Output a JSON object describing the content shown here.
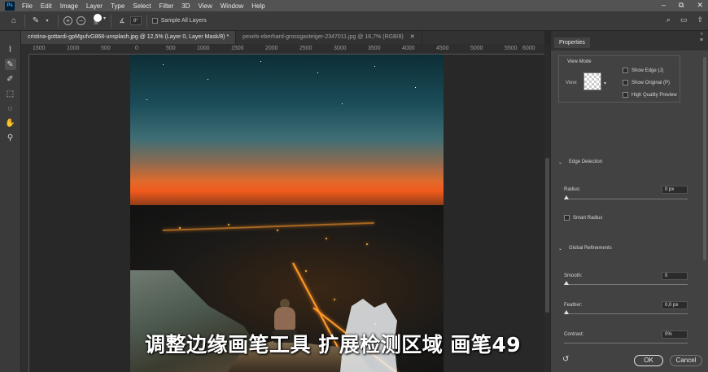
{
  "app": {
    "logo": "Ps"
  },
  "menu": [
    "File",
    "Edit",
    "Image",
    "Layer",
    "Type",
    "Select",
    "Filter",
    "3D",
    "View",
    "Window",
    "Help"
  ],
  "window_controls": {
    "minimize": "–",
    "restore": "⧉",
    "close": "✕"
  },
  "options_bar": {
    "brush_size": "30",
    "angle_value": "0°",
    "sample_all_layers_label": "Sample All Layers",
    "sample_all_layers_checked": false
  },
  "tabs": [
    {
      "label": "cristina-gottardi-gpMgufvG868-unsplash.jpg @ 12,5% (Layer 0, Layer Mask/8) *",
      "active": true
    },
    {
      "label": "pexels-eberhard-grossgasteiger-2347011.jpg @ 16,7% (RGB/8)",
      "active": false
    }
  ],
  "ruler": {
    "ticks": [
      "1500",
      "1000",
      "500",
      "0",
      "500",
      "1000",
      "1500",
      "2000",
      "2500",
      "3000",
      "3500",
      "4000",
      "4500",
      "5000",
      "5500",
      "6000"
    ]
  },
  "properties": {
    "title": "Properties",
    "view_mode": {
      "label": "View Mode",
      "view_label": "View:",
      "show_edge": {
        "label": "Show Edge (J)",
        "checked": false
      },
      "show_original": {
        "label": "Show Original (P)",
        "checked": false
      },
      "high_quality_preview": {
        "label": "High Quality Preview",
        "checked": false
      }
    },
    "edge_detection": {
      "title": "Edge Detection",
      "radius_label": "Radius:",
      "radius_value": "0 px",
      "smart_radius": {
        "label": "Smart Radius",
        "checked": false
      }
    },
    "global_refinements": {
      "title": "Global Refinements",
      "smooth_label": "Smooth:",
      "smooth_value": "0",
      "feather_label": "Feather:",
      "feather_value": "0,0 px",
      "contrast_label": "Contrast:",
      "contrast_value": "0%"
    },
    "ok_label": "OK",
    "cancel_label": "Cancel"
  },
  "subtitle": "调整边缘画笔工具 扩展检测区域 画笔49"
}
